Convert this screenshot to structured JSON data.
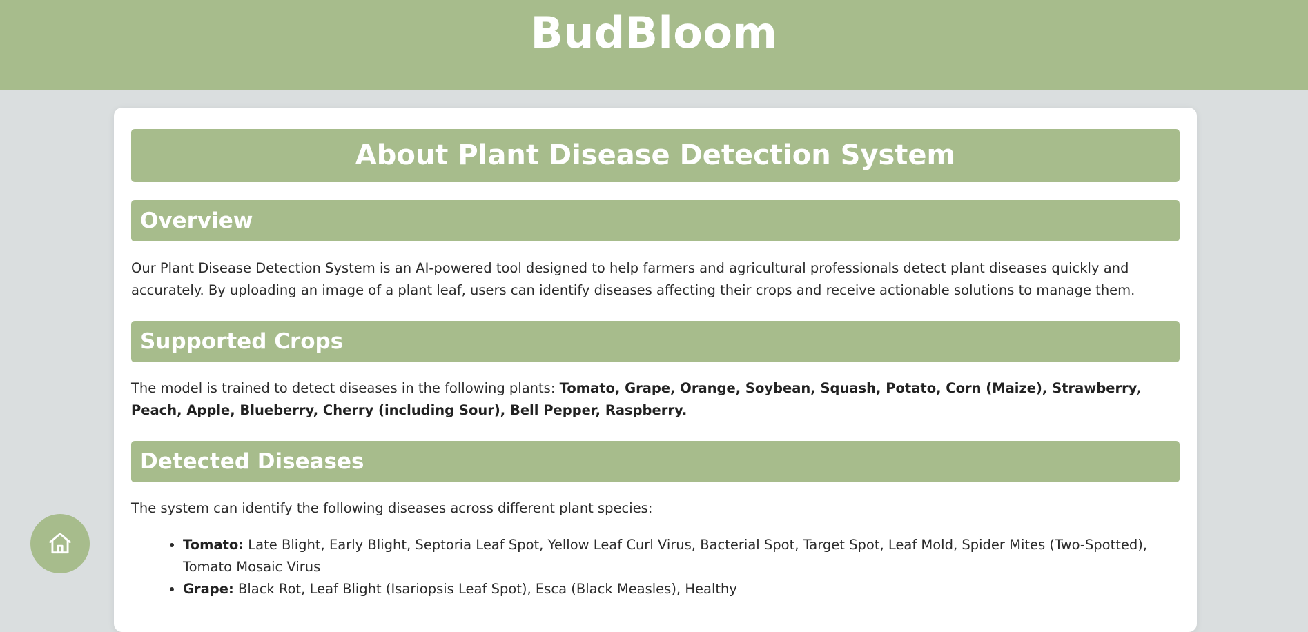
{
  "header": {
    "brand": "BudBloom"
  },
  "main": {
    "title": "About Plant Disease Detection System",
    "overview": {
      "heading": "Overview",
      "text": "Our Plant Disease Detection System is an AI-powered tool designed to help farmers and agricultural professionals detect plant diseases quickly and accurately. By uploading an image of a plant leaf, users can identify diseases affecting their crops and receive actionable solutions to manage them."
    },
    "crops": {
      "heading": "Supported Crops",
      "intro": "The model is trained to detect diseases in the following plants: ",
      "list": "Tomato, Grape, Orange, Soybean, Squash, Potato, Corn (Maize), Strawberry, Peach, Apple, Blueberry, Cherry (including Sour), Bell Pepper, Raspberry."
    },
    "diseases": {
      "heading": "Detected Diseases",
      "intro": "The system can identify the following diseases across different plant species:",
      "items": [
        {
          "crop": "Tomato:",
          "list": " Late Blight, Early Blight, Septoria Leaf Spot, Yellow Leaf Curl Virus, Bacterial Spot, Target Spot, Leaf Mold, Spider Mites (Two-Spotted), Tomato Mosaic Virus"
        },
        {
          "crop": "Grape:",
          "list": " Black Rot, Leaf Blight (Isariopsis Leaf Spot), Esca (Black Measles), Healthy"
        }
      ]
    }
  },
  "home_button": {
    "icon": "home-icon"
  },
  "colors": {
    "accent": "#a7bc8c",
    "background": "#dadedf",
    "card": "#ffffff"
  }
}
